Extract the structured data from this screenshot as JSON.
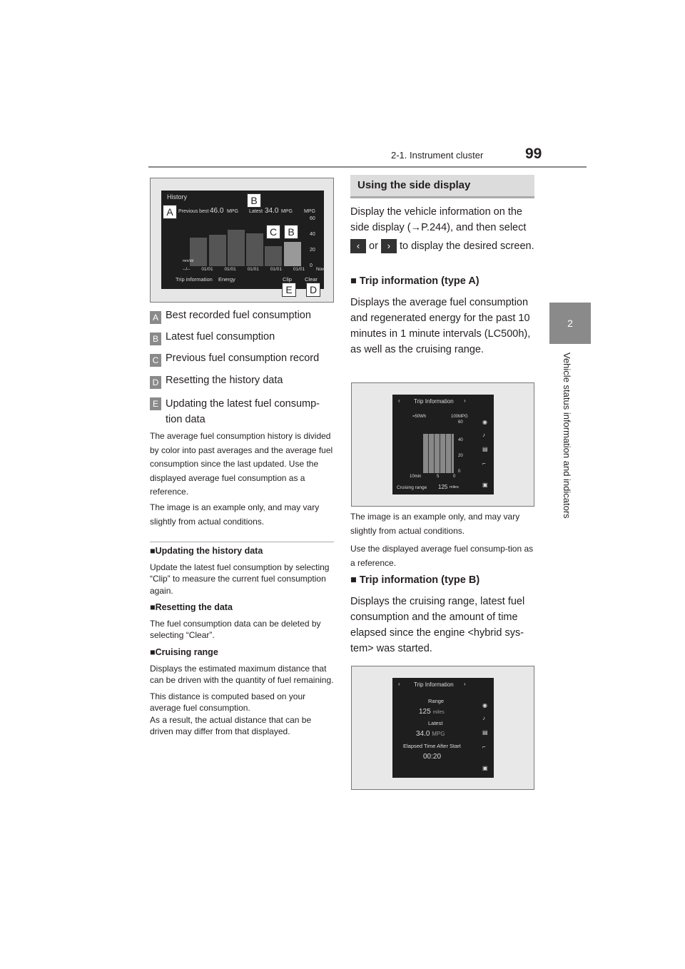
{
  "header": {
    "section": "2-1. Instrument cluster",
    "page": "99"
  },
  "side_tab": {
    "number": "2",
    "label": "Vehicle status information and indicators"
  },
  "fig1": {
    "title": "History",
    "prev_best_label": "Previous best",
    "prev_best_value": "46.0",
    "unit": "MPG",
    "latest_label": "Latest",
    "latest_value": "34.0",
    "axis_unit": "MPG",
    "ticks": [
      "60",
      "40",
      "20",
      "0"
    ],
    "date_label": "mm/dd",
    "dates": [
      "--/--",
      "01/01",
      "01/01",
      "01/01",
      "01/01",
      "01/01",
      "Now"
    ],
    "tab1": "Trip information",
    "tab2": "Energy",
    "clip": "Clip",
    "clear": "Clear",
    "callouts": [
      "A",
      "B",
      "C",
      "B",
      "E",
      "D"
    ]
  },
  "legend": [
    {
      "letter": "A",
      "text": "Best recorded fuel consumption"
    },
    {
      "letter": "B",
      "text": "Latest fuel consumption"
    },
    {
      "letter": "C",
      "text": "Previous fuel consumption record"
    },
    {
      "letter": "D",
      "text": "Resetting the history data"
    },
    {
      "letter": "E",
      "text": "Updating the latest fuel consump-",
      "text2": "tion data"
    }
  ],
  "note1": "The average fuel consumption history is divided by color into past averages and the average fuel consumption since the last updated. Use the displayed average fuel consumption as a reference.",
  "note2": "The image is an example only, and may vary slightly from actual conditions.",
  "sub1": {
    "title": "Updating the history data",
    "text": "Update the latest fuel consumption by selecting “Clip” to measure the current fuel consumption again."
  },
  "sub2": {
    "title": "Resetting the data",
    "text": "The fuel consumption data can be deleted by selecting “Clear”."
  },
  "sub3": {
    "title": "Cruising range",
    "text": "Displays the estimated maximum distance that can be driven with the quantity of fuel remaining.",
    "text2": "This distance is computed based on your average fuel consumption.",
    "text3": "As a result, the actual distance that can be driven may differ from that displayed."
  },
  "right": {
    "heading": "Using the side display",
    "intro1": "Display the vehicle information on the side display (→P.244), and then select",
    "or": "or",
    "intro2": "to display the desired screen.",
    "typeA_title": "Trip information (type A)",
    "typeA_text": "Displays the average fuel consumption and regenerated energy for the past 10 minutes in 1 minute intervals (LC500h), as well as the cruising range.",
    "note": "The image is an example only, and may vary slightly from actual conditions.",
    "note2": "Use the displayed average fuel consump-tion as a reference.",
    "typeB_title": "Trip information (type B)",
    "typeB_text": "Displays the cruising range, latest fuel consumption and the amount of time elapsed since the engine <hybrid sys-tem> was started."
  },
  "fig2": {
    "title": "Trip Information",
    "legend": "=50Wh",
    "unit": "100MPG",
    "ticks": [
      "60",
      "40",
      "20",
      "0"
    ],
    "x": [
      "10min",
      "5",
      "0"
    ],
    "range_label": "Cruising range",
    "range_value": "125",
    "range_unit": "miles"
  },
  "fig3": {
    "title": "Trip Information",
    "range_label": "Range",
    "range_value": "125",
    "range_unit": "miles",
    "latest_label": "Latest",
    "latest_value": "34.0",
    "latest_unit": "MPG",
    "elapsed_label": "Elapsed Time After Start",
    "elapsed_value": "00:20"
  }
}
